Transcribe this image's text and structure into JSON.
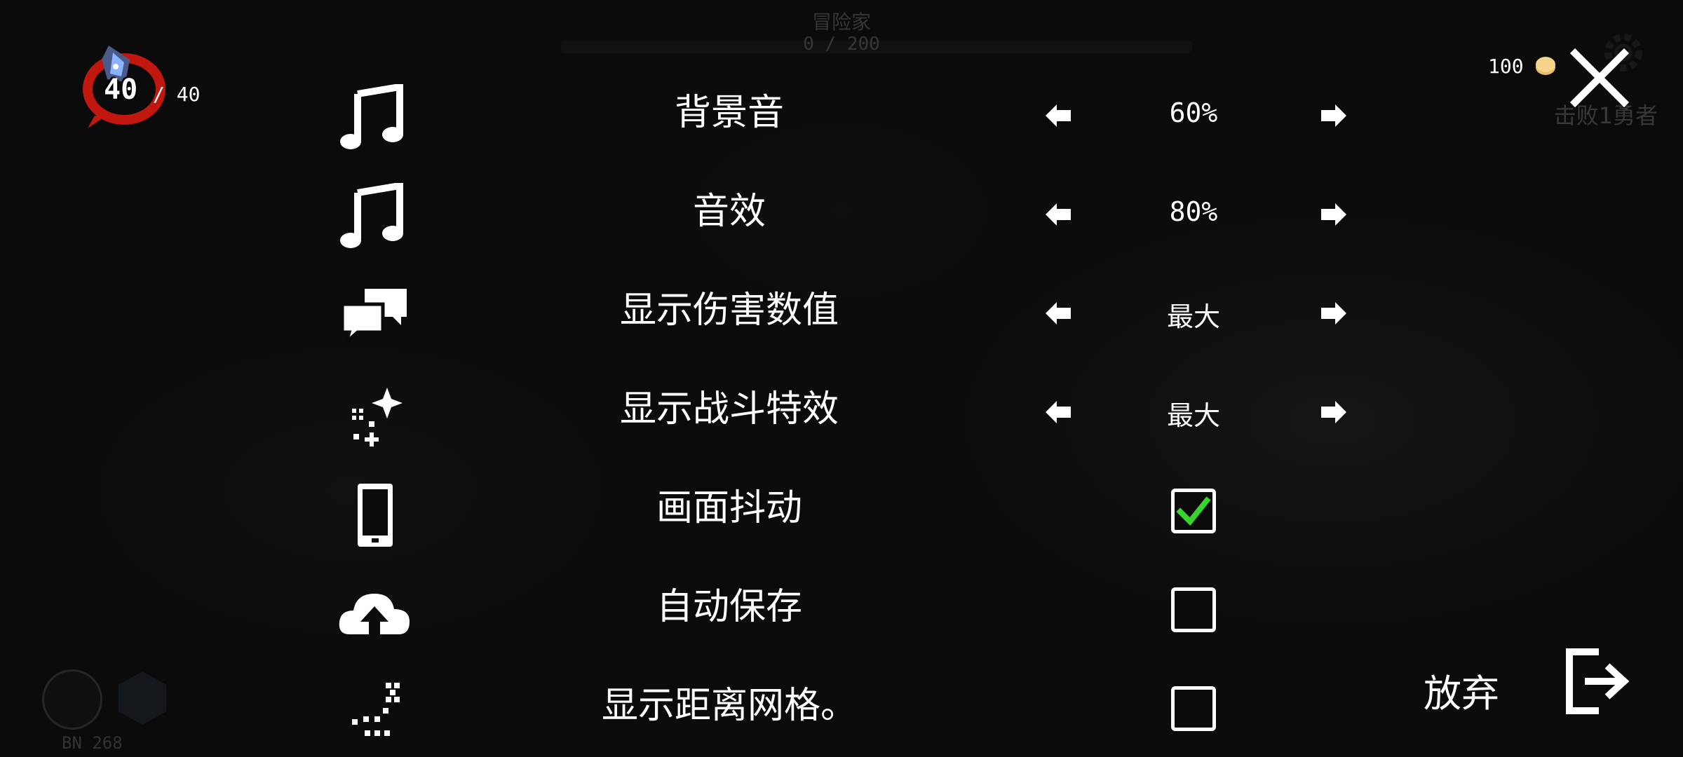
{
  "hud": {
    "top_title": "冒险家",
    "top_count": "0 / 200",
    "goal_text": "击败1勇者",
    "bn_label": "BN 268",
    "hp_current": "40",
    "hp_max": "/ 40",
    "coins": "100"
  },
  "settings": [
    {
      "icon": "music-note-icon",
      "label": "背景音",
      "type": "slider",
      "value": "60%"
    },
    {
      "icon": "music-note-icon",
      "label": "音效",
      "type": "slider",
      "value": "80%"
    },
    {
      "icon": "speech-bubbles-icon",
      "label": "显示伤害数值",
      "type": "slider",
      "value": "最大"
    },
    {
      "icon": "sparkles-icon",
      "label": "显示战斗特效",
      "type": "slider",
      "value": "最大"
    },
    {
      "icon": "phone-icon",
      "label": "画面抖动",
      "type": "checkbox",
      "checked": true
    },
    {
      "icon": "cloud-upload-icon",
      "label": "自动保存",
      "type": "checkbox",
      "checked": false
    },
    {
      "icon": "grid-dots-icon",
      "label": "显示距离网格。",
      "type": "checkbox",
      "checked": false
    }
  ],
  "give_up": {
    "label": "放弃",
    "icon": "exit-icon"
  },
  "colors": {
    "background": "#0b0b0b",
    "text": "#ffffff",
    "checkmark": "#39d32e",
    "orb_red": "#c0180f",
    "coin": "#e8c06a"
  }
}
